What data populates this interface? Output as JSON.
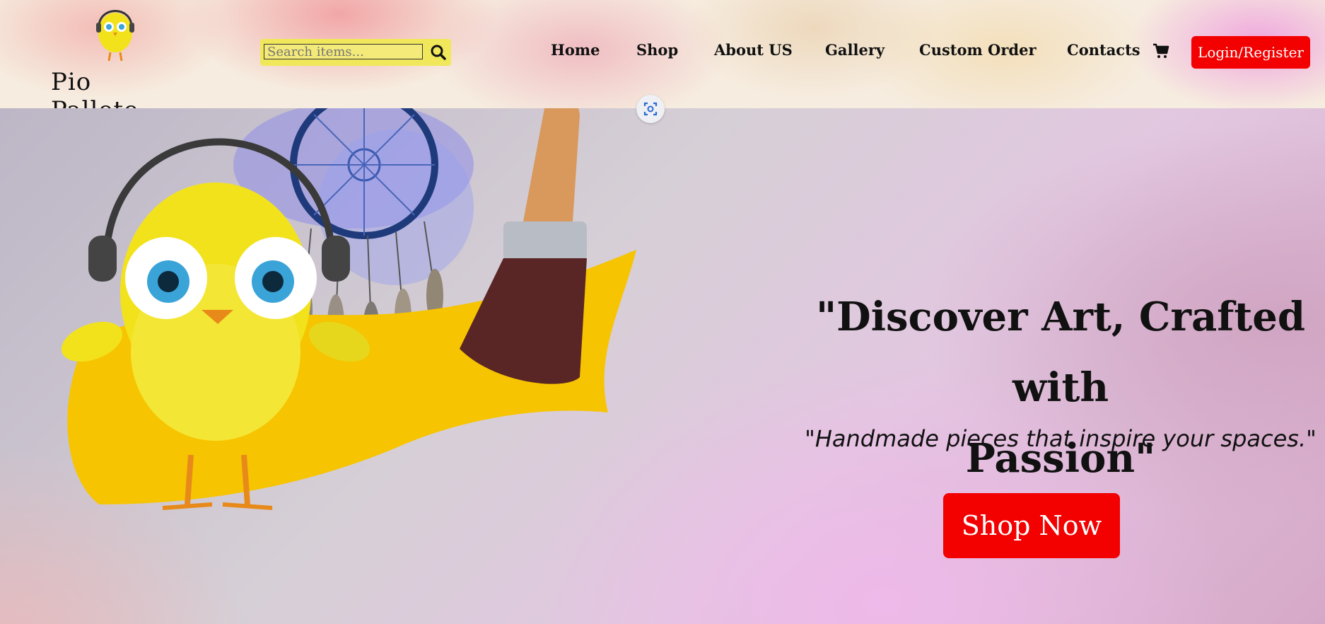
{
  "brand": {
    "name": "Pio Pallete"
  },
  "search": {
    "placeholder": "Search items..."
  },
  "nav": {
    "items": [
      {
        "label": "Home"
      },
      {
        "label": "Shop"
      },
      {
        "label": "About US"
      },
      {
        "label": "Gallery"
      },
      {
        "label": "Custom Order"
      },
      {
        "label": "Contacts"
      }
    ],
    "cart_icon": "cart-icon",
    "login_label": "Login/Register"
  },
  "hero": {
    "headline_line1": "\"Discover Art, Crafted with",
    "headline_line2": "Passion\"",
    "subline": "\"Handmade pieces that inspire your spaces.\"",
    "cta_label": "Shop Now"
  },
  "colors": {
    "accent": "#f30000",
    "search_bg": "#f0e85a",
    "chick_yellow": "#f2e21c"
  }
}
